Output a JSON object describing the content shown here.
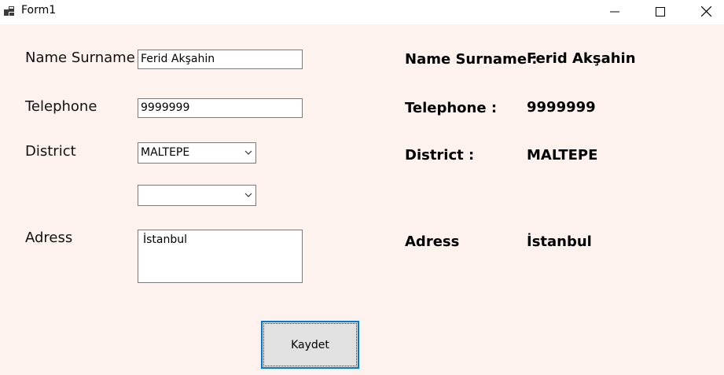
{
  "window": {
    "title": "Form1",
    "icons": {
      "app": "form-app-icon",
      "minimize": "minimize-icon",
      "maximize": "maximize-icon",
      "close": "close-icon"
    }
  },
  "form": {
    "labels": {
      "name_surname": "Name Surname",
      "telephone": "Telephone",
      "district": "District",
      "adress": "Adress"
    },
    "inputs": {
      "name_surname": "Ferid Akşahin",
      "telephone": "9999999",
      "district_selected": "MALTEPE",
      "second_selected": "",
      "adress": "İstanbul"
    },
    "save_button": "Kaydet"
  },
  "summary": {
    "name_label": "Name Surname :",
    "name_value": "Ferid Akşahin",
    "telephone_label": "Telephone :",
    "telephone_value": "9999999",
    "district_label": "District :",
    "district_value": "MALTEPE",
    "adress_label": "Adress",
    "adress_value": "İstanbul"
  },
  "colors": {
    "client_bg": "#fdf2ee",
    "button_border": "#0078d7",
    "button_bg": "#e1e1e1"
  }
}
